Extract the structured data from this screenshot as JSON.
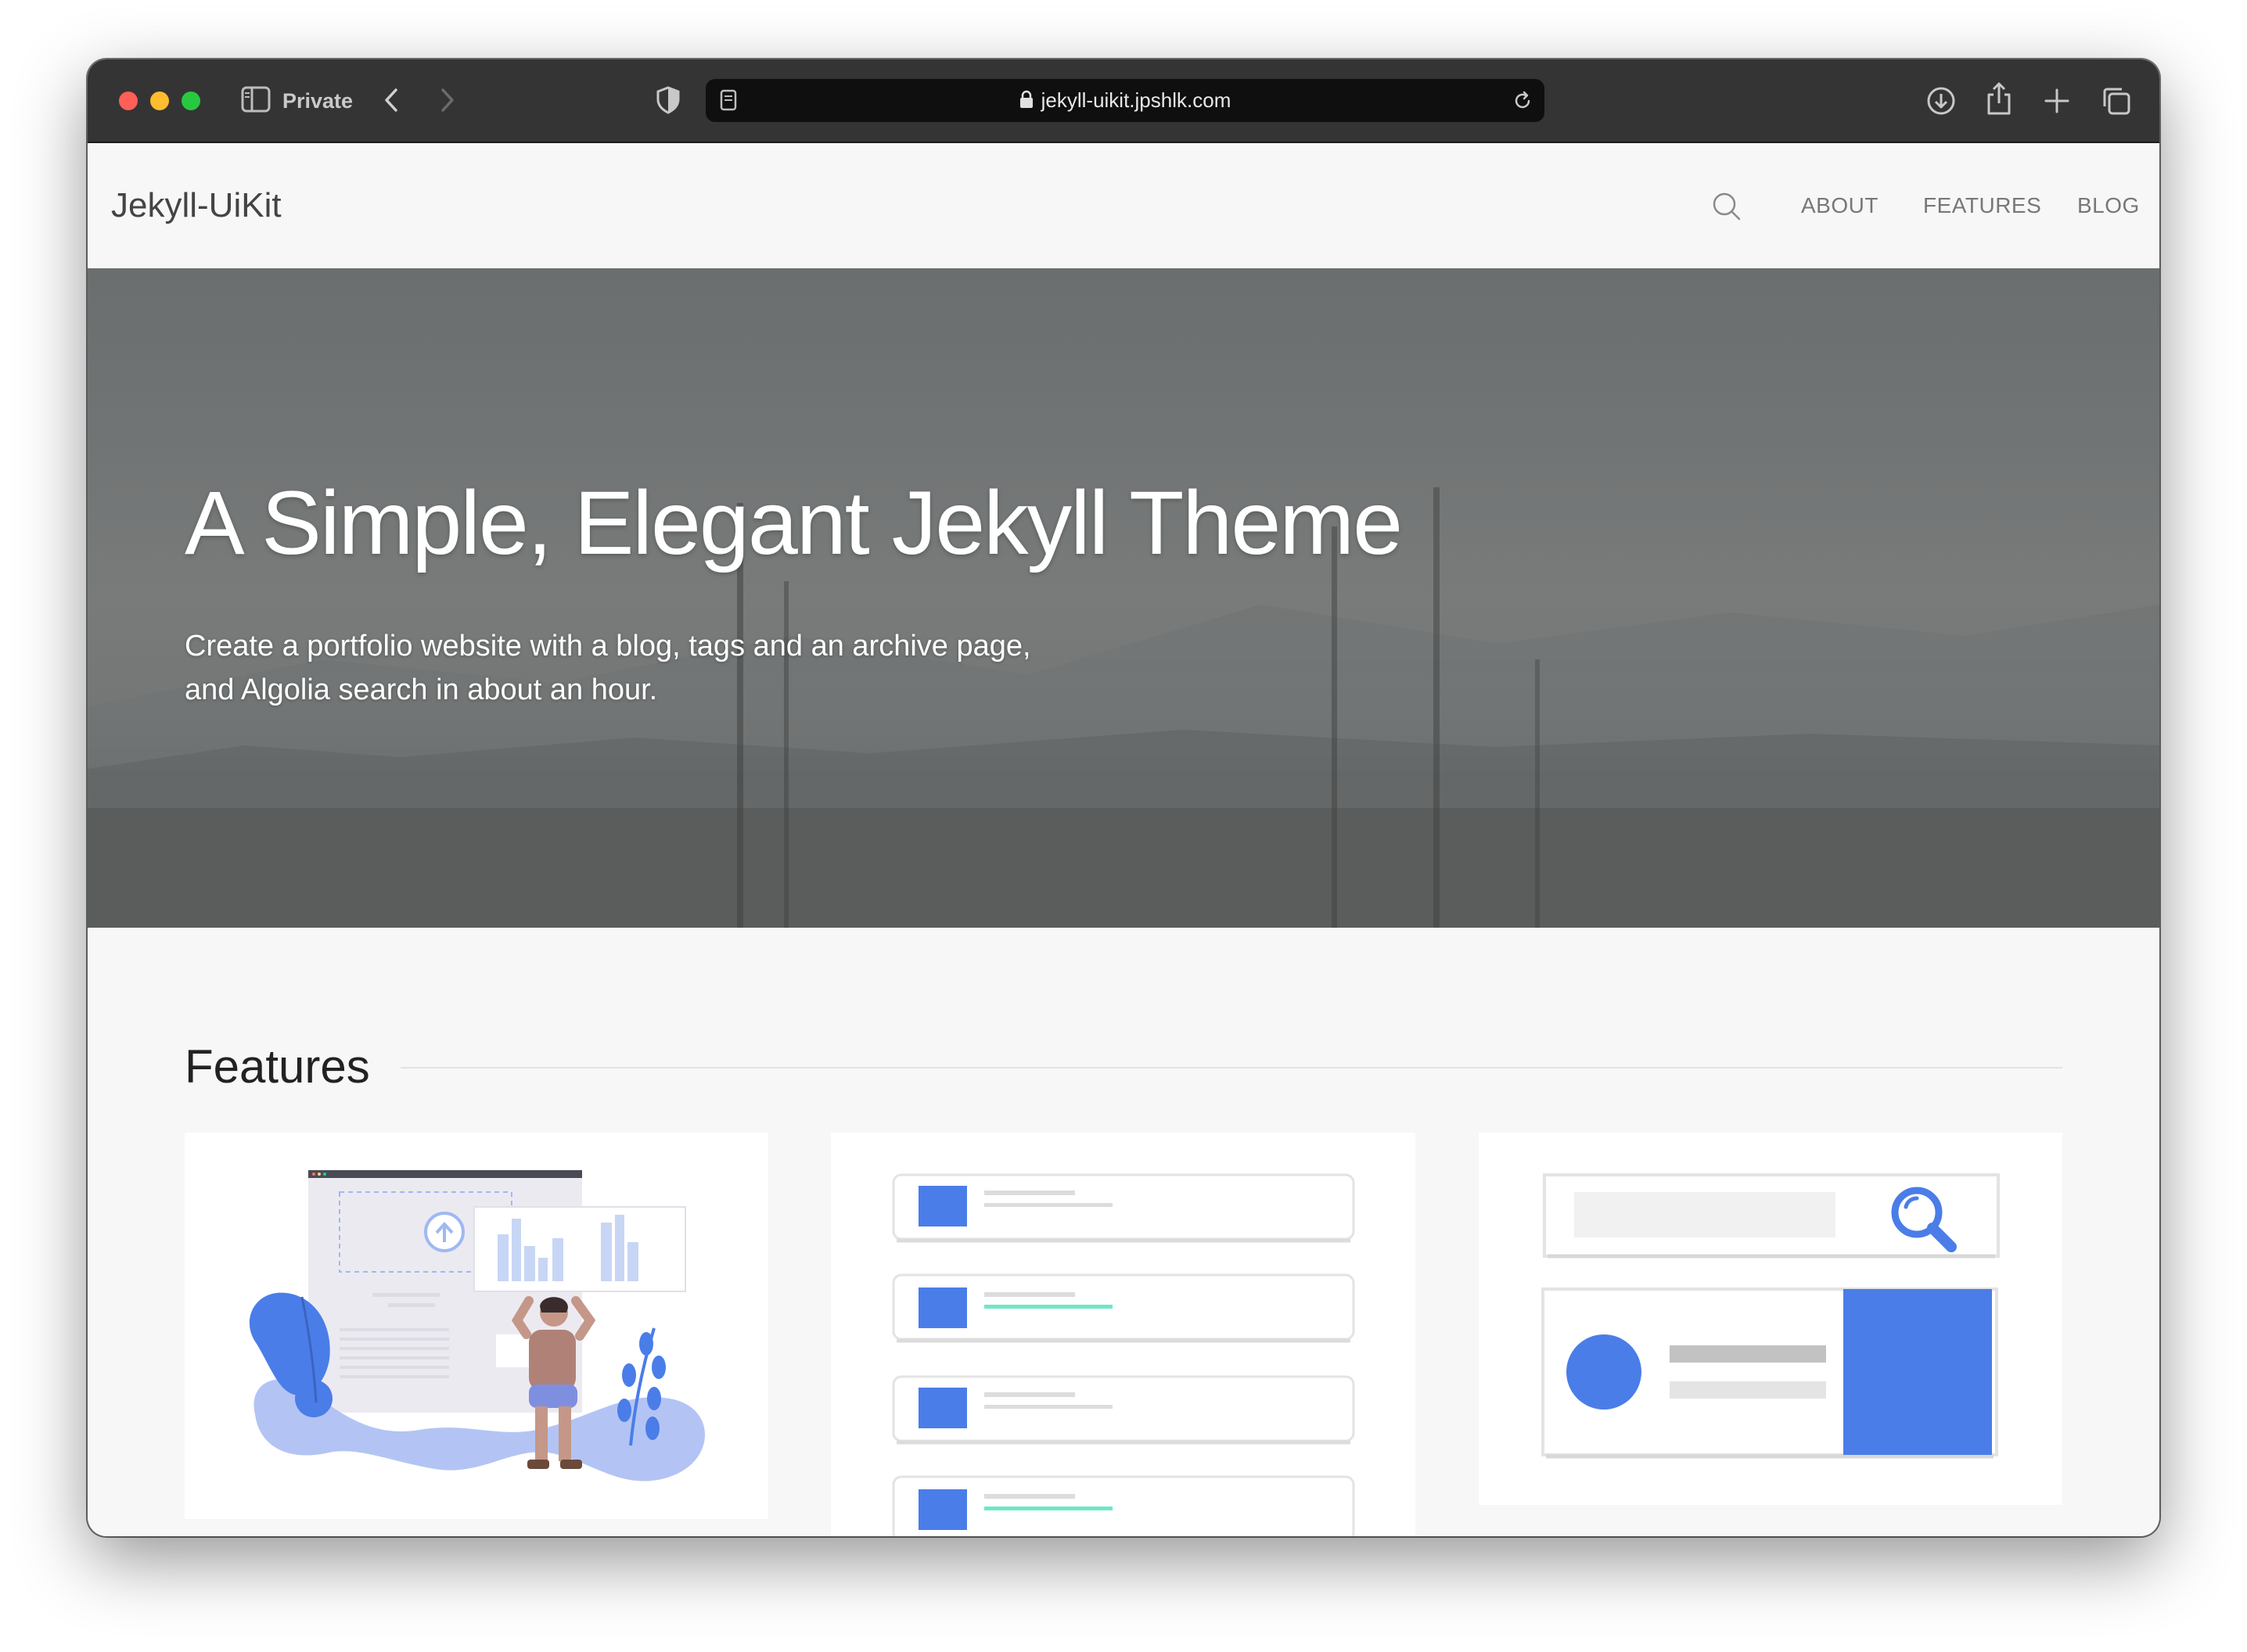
{
  "browser": {
    "private_label": "Private",
    "url": "jekyll-uikit.jpshlk.com",
    "icons": [
      "sidebar-icon",
      "back-icon",
      "forward-icon",
      "shield-icon",
      "reader-icon",
      "lock-icon",
      "reload-icon",
      "download-icon",
      "share-icon",
      "new-tab-icon",
      "tabs-overview-icon"
    ]
  },
  "site": {
    "brand": "Jekyll-UiKit",
    "nav": {
      "about": "ABOUT",
      "features": "FEATURES",
      "blog": "BLOG"
    }
  },
  "hero": {
    "title": "A Simple, Elegant Jekyll Theme",
    "subtitle_line1": "Create a portfolio website with a blog, tags and an archive page,",
    "subtitle_line2": "and Algolia search in about an hour."
  },
  "features": {
    "heading": "Features"
  },
  "colors": {
    "accent": "#4a7de8",
    "accent_light": "#9fb8f2",
    "teal": "#6ee7c9",
    "toolbar": "#353434",
    "page_bg": "#f7f7f7"
  }
}
